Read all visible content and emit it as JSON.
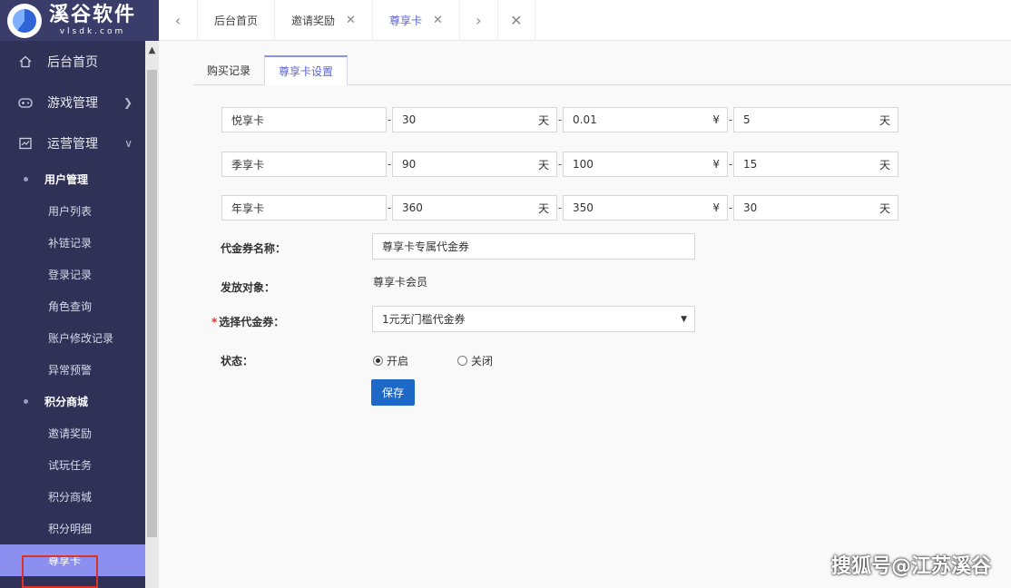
{
  "logo": {
    "name": "溪谷软件",
    "domain": "vlsdk.com"
  },
  "nav": {
    "home": "后台首页",
    "games": "游戏管理",
    "ops": "运营管理",
    "user_group": "用户管理",
    "user_items": [
      "用户列表",
      "补链记录",
      "登录记录",
      "角色查询",
      "账户修改记录",
      "异常预警"
    ],
    "points_group": "积分商城",
    "points_items": [
      "邀请奖励",
      "试玩任务",
      "积分商城",
      "积分明细",
      "尊享卡"
    ]
  },
  "topbar": {
    "tabs": [
      "后台首页",
      "邀请奖励",
      "尊享卡"
    ]
  },
  "content": {
    "tabs": [
      "购买记录",
      "尊享卡设置"
    ],
    "cards": [
      {
        "name": "悦享卡",
        "days": "30",
        "price": "0.01",
        "bonus_days": "5"
      },
      {
        "name": "季享卡",
        "days": "90",
        "price": "100",
        "bonus_days": "15"
      },
      {
        "name": "年享卡",
        "days": "360",
        "price": "350",
        "bonus_days": "30"
      }
    ],
    "units": {
      "day": "天",
      "yen": "¥"
    },
    "coupon_name_label": "代金券名称：",
    "coupon_name_value": "尊享卡专属代金券",
    "target_label": "发放对象：",
    "target_value": "尊享卡会员",
    "select_label": "选择代金券：",
    "select_value": "1元无门槛代金券",
    "status_label": "状态：",
    "status_on": "开启",
    "status_off": "关闭",
    "save": "保存"
  },
  "watermark": "搜狐号@江苏溪谷",
  "colors": {
    "sidebar": "#2f3157",
    "accent": "#8b8ff0",
    "primary_button": "#1e68c8",
    "highlight_box": "#e0302a"
  }
}
